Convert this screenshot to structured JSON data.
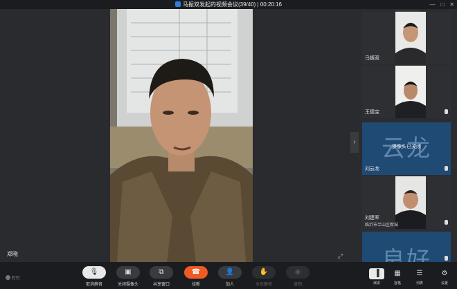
{
  "window": {
    "title": "马振双发起的视频会议(39/40) | 00:20:16"
  },
  "main": {
    "speaker_name": "郑晓"
  },
  "panel": {
    "tiles": [
      {
        "name": "马振双",
        "camera_off": false
      },
      {
        "name": "王德宝",
        "camera_off": false
      },
      {
        "name": "刘云龙",
        "camera_off": true,
        "avatar_text": "云龙",
        "off_text": "摄像头已关闭"
      },
      {
        "name": "刘建军",
        "sub": "临沂市兰山区新城",
        "camera_off": false
      },
      {
        "name": "",
        "camera_off": true,
        "avatar_text": "良好",
        "off_text": ""
      }
    ]
  },
  "toolbar": {
    "logo_text": "钉钉",
    "buttons": [
      {
        "label": "取消静音"
      },
      {
        "label": "关闭摄像头"
      },
      {
        "label": "共享窗口"
      },
      {
        "label": "挂断"
      },
      {
        "label": "加人"
      },
      {
        "label": "全员静音"
      },
      {
        "label": "录制"
      }
    ],
    "views": [
      {
        "label": "演讲"
      },
      {
        "label": "宫格"
      },
      {
        "label": "列表"
      },
      {
        "label": "设置"
      }
    ]
  },
  "colors": {
    "hangup": "#f05a24",
    "camera_off_tile": "#1f4a74",
    "background": "#1e1f22"
  }
}
